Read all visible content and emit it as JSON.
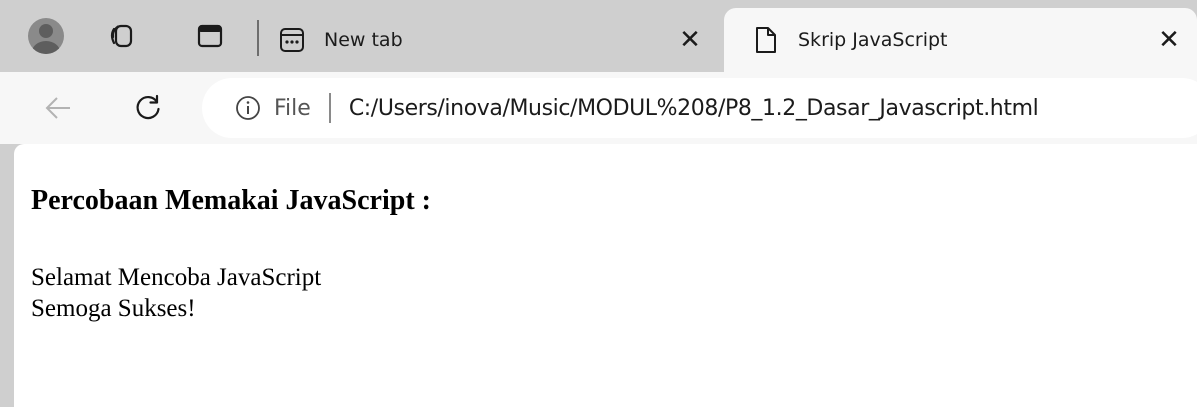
{
  "browser": {
    "tabs": [
      {
        "title": "New tab",
        "close_glyph": "✕",
        "active": false,
        "icon": "new-tab-icon"
      },
      {
        "title": "Skrip JavaScript",
        "close_glyph": "✕",
        "active": true,
        "icon": "page-icon"
      }
    ],
    "address_bar": {
      "scheme_label": "File",
      "url": "C:/Users/inova/Music/MODUL%208/P8_1.2_Dasar_Javascript.html",
      "info_icon": "info-icon"
    },
    "nav": {
      "back_icon": "back-arrow-icon",
      "refresh_icon": "refresh-icon"
    }
  },
  "page": {
    "heading": "Percobaan Memakai JavaScript :",
    "lines": [
      "Selamat Mencoba JavaScript",
      "Semoga Sukses!"
    ]
  }
}
